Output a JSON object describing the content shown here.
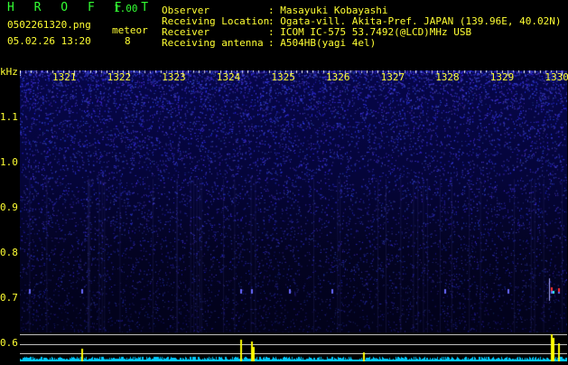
{
  "header": {
    "app_title": "H R O F F T",
    "version": "1.00",
    "filename": "0502261320.png",
    "datetime": "05.02.26 13:20",
    "meteor_label": "meteor",
    "meteor_count": "8"
  },
  "info": {
    "observer_label": "Observer",
    "observer_value": ": Masayuki Kobayashi",
    "location_label": "Receiving Location",
    "location_value": ": Ogata-vill. Akita-Pref. JAPAN (139.96E, 40.02N)",
    "receiver_label": "Receiver",
    "receiver_value": ": ICOM IC-575 53.7492(@LCD)MHz USB",
    "antenna_label": "Receiving antenna",
    "antenna_value": ": A504HB(yagi 4el)"
  },
  "axis": {
    "unit": "kHz",
    "time_ticks": [
      "1321",
      "1322",
      "1323",
      "1324",
      "1325",
      "1326",
      "1327",
      "1328",
      "1329",
      "1330"
    ],
    "freq_ticks": [
      "1.1",
      "1.0",
      "0.9",
      "0.8",
      "0.7",
      "0.6"
    ]
  },
  "colors": {
    "text_yellow": "#ffff33",
    "text_green": "#33ff33",
    "background": "#000000",
    "spectrogram_dots": "#3a3aff",
    "lower_trace": "#00ccff",
    "lower_spikes": "#ffff00"
  }
}
